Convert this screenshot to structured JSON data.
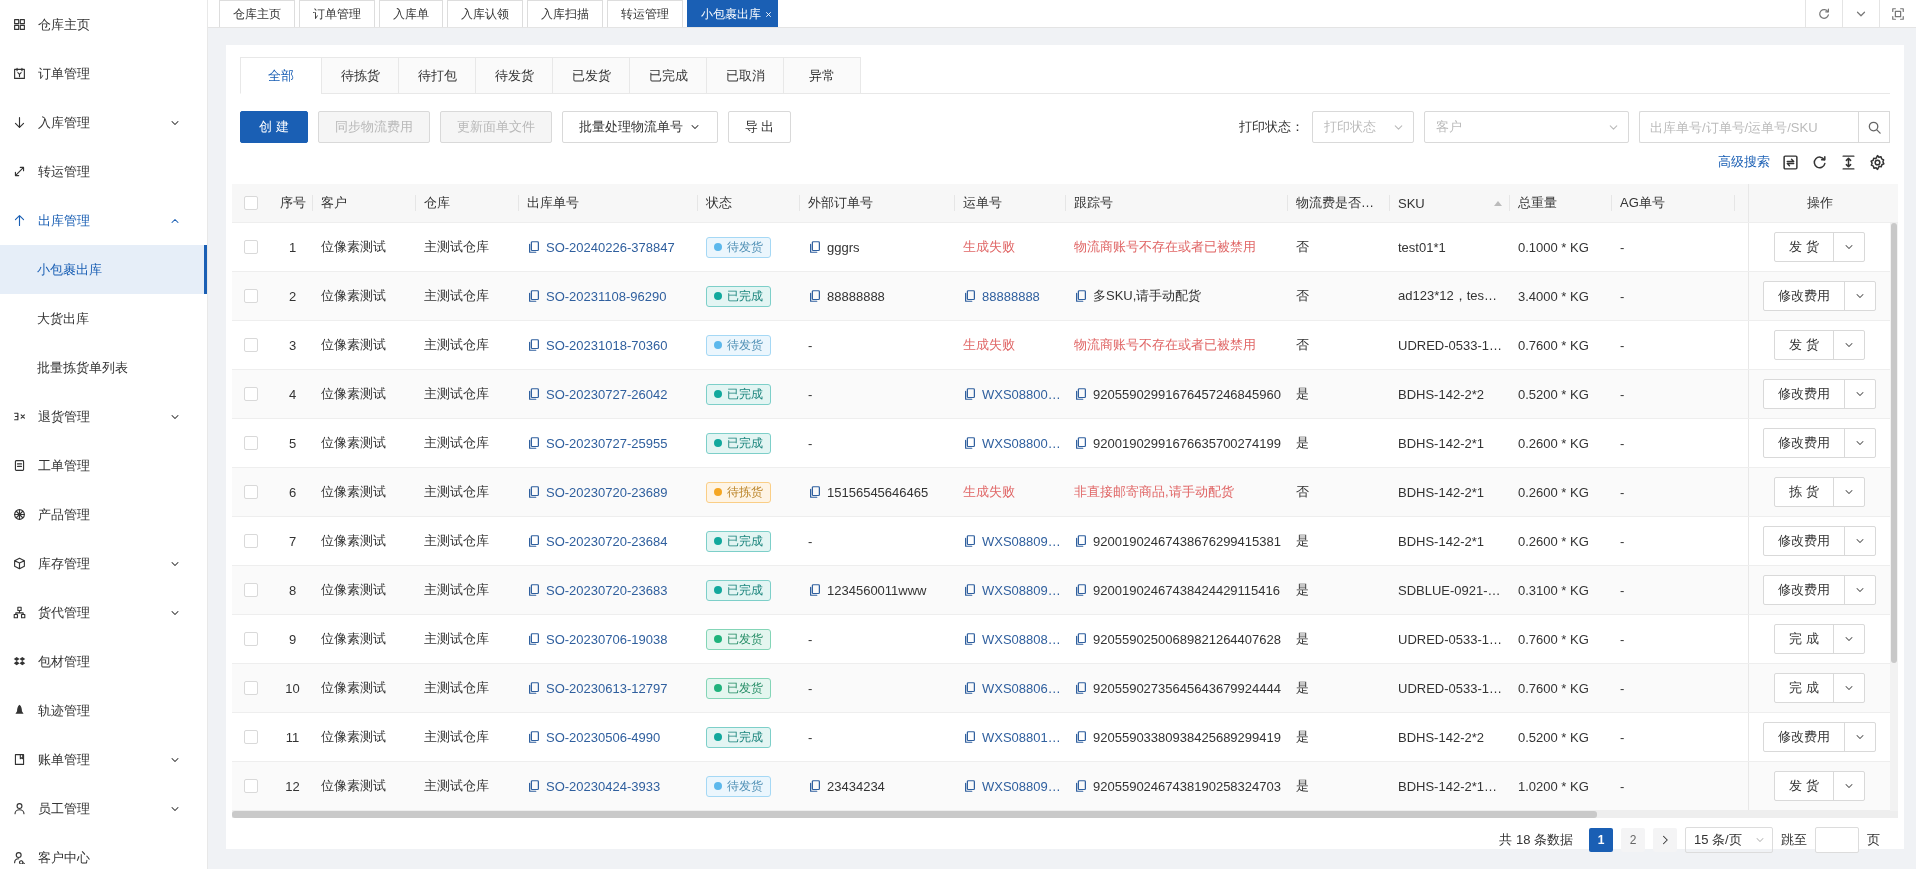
{
  "top_tabs": [
    {
      "label": "仓库主页",
      "selected": false,
      "closable": false
    },
    {
      "label": "订单管理",
      "selected": false,
      "closable": false
    },
    {
      "label": "入库单",
      "selected": false,
      "closable": false
    },
    {
      "label": "入库认领",
      "selected": false,
      "closable": false
    },
    {
      "label": "入库扫描",
      "selected": false,
      "closable": false
    },
    {
      "label": "转运管理",
      "selected": false,
      "closable": false
    },
    {
      "label": "小包裹出库",
      "selected": true,
      "closable": true
    }
  ],
  "sidebar": {
    "items": [
      {
        "label": "仓库主页",
        "selected": false,
        "expandable": false,
        "expanded": false
      },
      {
        "label": "订单管理",
        "selected": false,
        "expandable": false,
        "expanded": false
      },
      {
        "label": "入库管理",
        "selected": false,
        "expandable": true,
        "expanded": false
      },
      {
        "label": "转运管理",
        "selected": false,
        "expandable": false,
        "expanded": false
      },
      {
        "label": "出库管理",
        "selected": false,
        "expandable": true,
        "expanded": true,
        "children": [
          {
            "label": "小包裹出库",
            "selected": true
          },
          {
            "label": "大货出库",
            "selected": false
          },
          {
            "label": "批量拣货单列表",
            "selected": false
          }
        ]
      },
      {
        "label": "退货管理",
        "selected": false,
        "expandable": true,
        "expanded": false
      },
      {
        "label": "工单管理",
        "selected": false,
        "expandable": false,
        "expanded": false
      },
      {
        "label": "产品管理",
        "selected": false,
        "expandable": false,
        "expanded": false
      },
      {
        "label": "库存管理",
        "selected": false,
        "expandable": true,
        "expanded": false
      },
      {
        "label": "货代管理",
        "selected": false,
        "expandable": true,
        "expanded": false
      },
      {
        "label": "包材管理",
        "selected": false,
        "expandable": false,
        "expanded": false
      },
      {
        "label": "轨迹管理",
        "selected": false,
        "expandable": false,
        "expanded": false
      },
      {
        "label": "账单管理",
        "selected": false,
        "expandable": true,
        "expanded": false
      },
      {
        "label": "员工管理",
        "selected": false,
        "expandable": true,
        "expanded": false
      },
      {
        "label": "客户中心",
        "selected": false,
        "expandable": false,
        "expanded": false
      }
    ]
  },
  "status_tabs": [
    {
      "label": "全部",
      "selected": true
    },
    {
      "label": "待拣货",
      "selected": false
    },
    {
      "label": "待打包",
      "selected": false
    },
    {
      "label": "待发货",
      "selected": false
    },
    {
      "label": "已发货",
      "selected": false
    },
    {
      "label": "已完成",
      "selected": false
    },
    {
      "label": "已取消",
      "selected": false
    },
    {
      "label": "异常",
      "selected": false
    }
  ],
  "toolbar": {
    "buttons": [
      {
        "label": "创 建",
        "kind": "primary"
      },
      {
        "label": "同步物流费用",
        "kind": "disabled"
      },
      {
        "label": "更新面单文件",
        "kind": "disabled"
      },
      {
        "label": "批量处理物流单号",
        "kind": "dropdown"
      },
      {
        "label": "导 出",
        "kind": "default"
      }
    ]
  },
  "filters": {
    "print_label": "打印状态：",
    "print_select": {
      "placeholder": "打印状态"
    },
    "customer_select": {
      "placeholder": "客户"
    },
    "search": {
      "placeholder": "出库单号/订单号/运单号/SKU"
    }
  },
  "advanced_search": "高级搜索",
  "table": {
    "header_checked": false,
    "columns": [
      {
        "label": "序号",
        "sortable": false
      },
      {
        "label": "客户",
        "sortable": false
      },
      {
        "label": "仓库",
        "sortable": false
      },
      {
        "label": "出库单号",
        "sortable": false
      },
      {
        "label": "状态",
        "sortable": false
      },
      {
        "label": "外部订单号",
        "sortable": false
      },
      {
        "label": "运单号",
        "sortable": false
      },
      {
        "label": "跟踪号",
        "sortable": false
      },
      {
        "label": "物流费是否…",
        "sortable": false
      },
      {
        "label": "SKU",
        "sortable": true
      },
      {
        "label": "总重量",
        "sortable": false
      },
      {
        "label": "AG单号",
        "sortable": false
      },
      {
        "label": "操作",
        "sortable": false
      }
    ],
    "rows": [
      {
        "checked": false,
        "index": "1",
        "customer": "位像素测试",
        "warehouse": "主测试仓库",
        "order_no": "SO-20240226-378847",
        "status": {
          "label": "待发货",
          "color": "#5cb8ec"
        },
        "external_order": {
          "text": "gggrs",
          "kind": "copy"
        },
        "waybill": {
          "text": "生成失败",
          "kind": "error"
        },
        "tracking": {
          "text": "物流商账号不存在或者已被禁用",
          "kind": "error"
        },
        "fee_included": "否",
        "sku": "test01*1",
        "weight": "0.1000 * KG",
        "ag_no": "-",
        "action": "发 货"
      },
      {
        "checked": false,
        "index": "2",
        "customer": "位像素测试",
        "warehouse": "主测试仓库",
        "order_no": "SO-20231108-96290",
        "status": {
          "label": "已完成",
          "color": "#12a89d"
        },
        "external_order": {
          "text": "88888888",
          "kind": "copy"
        },
        "waybill": {
          "text": "88888888",
          "kind": "link"
        },
        "tracking": {
          "text": "多SKU,请手动配货",
          "kind": "copy"
        },
        "fee_included": "否",
        "sku": "ad123*12，tes…",
        "weight": "3.4000 * KG",
        "ag_no": "-",
        "action": "修改费用"
      },
      {
        "checked": false,
        "index": "3",
        "customer": "位像素测试",
        "warehouse": "主测试仓库",
        "order_no": "SO-20231018-70360",
        "status": {
          "label": "待发货",
          "color": "#5cb8ec"
        },
        "external_order": {
          "text": "-",
          "kind": "plain"
        },
        "waybill": {
          "text": "生成失败",
          "kind": "error"
        },
        "tracking": {
          "text": "物流商账号不存在或者已被禁用",
          "kind": "error"
        },
        "fee_included": "否",
        "sku": "UDRED-0533-1…",
        "weight": "0.7600 * KG",
        "ag_no": "-",
        "action": "发 货"
      },
      {
        "checked": false,
        "index": "4",
        "customer": "位像素测试",
        "warehouse": "主测试仓库",
        "order_no": "SO-20230727-26042",
        "status": {
          "label": "已完成",
          "color": "#12a89d"
        },
        "external_order": {
          "text": "-",
          "kind": "plain"
        },
        "waybill": {
          "text": "WXS08800…",
          "kind": "link"
        },
        "tracking": {
          "text": "92055902991676457246845960",
          "kind": "copy"
        },
        "fee_included": "是",
        "sku": "BDHS-142-2*2",
        "weight": "0.5200 * KG",
        "ag_no": "-",
        "action": "修改费用"
      },
      {
        "checked": false,
        "index": "5",
        "customer": "位像素测试",
        "warehouse": "主测试仓库",
        "order_no": "SO-20230727-25955",
        "status": {
          "label": "已完成",
          "color": "#12a89d"
        },
        "external_order": {
          "text": "-",
          "kind": "plain"
        },
        "waybill": {
          "text": "WXS08800…",
          "kind": "link"
        },
        "tracking": {
          "text": "92001902991676635700274199",
          "kind": "copy"
        },
        "fee_included": "是",
        "sku": "BDHS-142-2*1",
        "weight": "0.2600 * KG",
        "ag_no": "-",
        "action": "修改费用"
      },
      {
        "checked": false,
        "index": "6",
        "customer": "位像素测试",
        "warehouse": "主测试仓库",
        "order_no": "SO-20230720-23689",
        "status": {
          "label": "待拣货",
          "color": "#f5a623"
        },
        "external_order": {
          "text": "15156545646465",
          "kind": "copy"
        },
        "waybill": {
          "text": "生成失败",
          "kind": "error"
        },
        "tracking": {
          "text": "非直接邮寄商品,请手动配货",
          "kind": "error"
        },
        "fee_included": "否",
        "sku": "BDHS-142-2*1",
        "weight": "0.2600 * KG",
        "ag_no": "-",
        "action": "拣 货"
      },
      {
        "checked": false,
        "index": "7",
        "customer": "位像素测试",
        "warehouse": "主测试仓库",
        "order_no": "SO-20230720-23684",
        "status": {
          "label": "已完成",
          "color": "#12a89d"
        },
        "external_order": {
          "text": "-",
          "kind": "plain"
        },
        "waybill": {
          "text": "WXS08809…",
          "kind": "link"
        },
        "tracking": {
          "text": "92001902467438676299415381",
          "kind": "copy"
        },
        "fee_included": "是",
        "sku": "BDHS-142-2*1",
        "weight": "0.2600 * KG",
        "ag_no": "-",
        "action": "修改费用"
      },
      {
        "checked": false,
        "index": "8",
        "customer": "位像素测试",
        "warehouse": "主测试仓库",
        "order_no": "SO-20230720-23683",
        "status": {
          "label": "已完成",
          "color": "#12a89d"
        },
        "external_order": {
          "text": "1234560011www",
          "kind": "copy"
        },
        "waybill": {
          "text": "WXS08809…",
          "kind": "link"
        },
        "tracking": {
          "text": "92001902467438424429115416",
          "kind": "copy"
        },
        "fee_included": "是",
        "sku": "SDBLUE-0921-…",
        "weight": "0.3100 * KG",
        "ag_no": "-",
        "action": "修改费用"
      },
      {
        "checked": false,
        "index": "9",
        "customer": "位像素测试",
        "warehouse": "主测试仓库",
        "order_no": "SO-20230706-19038",
        "status": {
          "label": "已发货",
          "color": "#1fb37c"
        },
        "external_order": {
          "text": "-",
          "kind": "plain"
        },
        "waybill": {
          "text": "WXS08808…",
          "kind": "link"
        },
        "tracking": {
          "text": "92055902500689821264407628",
          "kind": "copy"
        },
        "fee_included": "是",
        "sku": "UDRED-0533-1…",
        "weight": "0.7600 * KG",
        "ag_no": "-",
        "action": "完 成"
      },
      {
        "checked": false,
        "index": "10",
        "customer": "位像素测试",
        "warehouse": "主测试仓库",
        "order_no": "SO-20230613-12797",
        "status": {
          "label": "已发货",
          "color": "#1fb37c"
        },
        "external_order": {
          "text": "-",
          "kind": "plain"
        },
        "waybill": {
          "text": "WXS08806…",
          "kind": "link"
        },
        "tracking": {
          "text": "92055902735645643679924444",
          "kind": "copy"
        },
        "fee_included": "是",
        "sku": "UDRED-0533-1…",
        "weight": "0.7600 * KG",
        "ag_no": "-",
        "action": "完 成"
      },
      {
        "checked": false,
        "index": "11",
        "customer": "位像素测试",
        "warehouse": "主测试仓库",
        "order_no": "SO-20230506-4990",
        "status": {
          "label": "已完成",
          "color": "#12a89d"
        },
        "external_order": {
          "text": "-",
          "kind": "plain"
        },
        "waybill": {
          "text": "WXS08801…",
          "kind": "link"
        },
        "tracking": {
          "text": "92055903380938425689299419",
          "kind": "copy"
        },
        "fee_included": "是",
        "sku": "BDHS-142-2*2",
        "weight": "0.5200 * KG",
        "ag_no": "-",
        "action": "修改费用"
      },
      {
        "checked": false,
        "index": "12",
        "customer": "位像素测试",
        "warehouse": "主测试仓库",
        "order_no": "SO-20230424-3933",
        "status": {
          "label": "待发货",
          "color": "#5cb8ec"
        },
        "external_order": {
          "text": "23434234",
          "kind": "copy"
        },
        "waybill": {
          "text": "WXS08809…",
          "kind": "link"
        },
        "tracking": {
          "text": "92055902467438190258324703",
          "kind": "copy"
        },
        "fee_included": "是",
        "sku": "BDHS-142-2*1…",
        "weight": "1.0200 * KG",
        "ag_no": "-",
        "action": "发 货"
      }
    ]
  },
  "pagination": {
    "total": "共 18 条数据",
    "pages": [
      {
        "label": "1",
        "selected": true
      },
      {
        "label": "2",
        "selected": false
      }
    ],
    "page_size": "15 条/页",
    "jump_label": "跳至",
    "jump_suffix": "页"
  }
}
